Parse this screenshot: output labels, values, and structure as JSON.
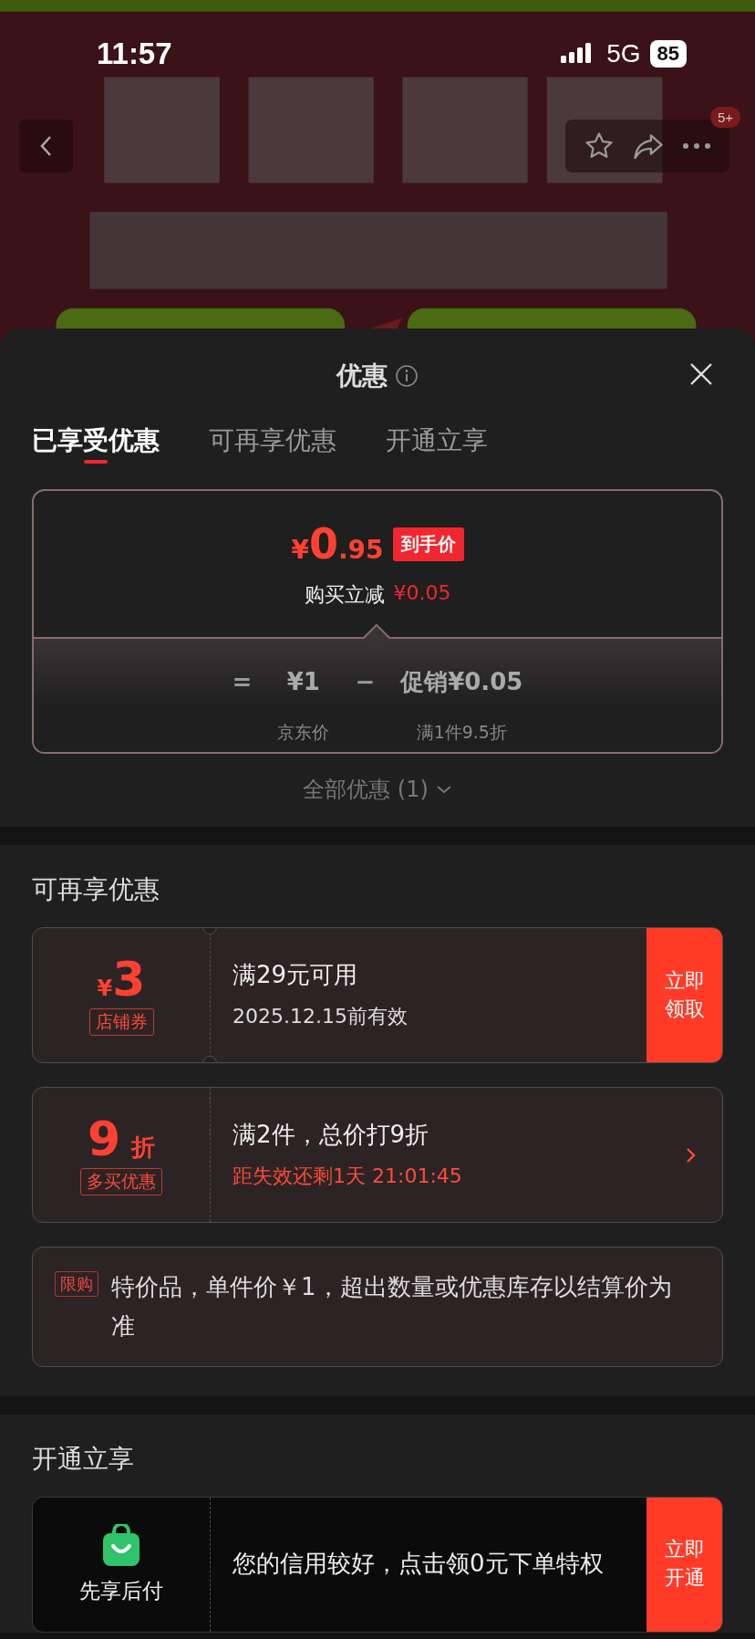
{
  "status_bar": {
    "time": "11:57",
    "network": "5G",
    "battery": "85"
  },
  "nav": {
    "badge": "5+"
  },
  "sheet": {
    "title": "优惠",
    "tabs": [
      {
        "label": "已享受优惠",
        "selected": true
      },
      {
        "label": "可再享优惠",
        "selected": false
      },
      {
        "label": "开通立享",
        "selected": false
      }
    ],
    "applied": {
      "price_symbol": "¥",
      "price_int": "0",
      "price_dec": ".95",
      "price_tag": "到手价",
      "reduction_label": "购买立减",
      "reduction_value": "¥0.05",
      "equals": "=",
      "jd_price": "¥1",
      "minus": "−",
      "promo": "促销¥0.05",
      "jd_label": "京东价",
      "promo_label": "满1件9.5折"
    },
    "all_link": "全部优惠 (1)"
  },
  "more": {
    "title": "可再享优惠",
    "offers": [
      {
        "kind": "coupon",
        "symbol": "¥",
        "amount": "3",
        "tag": "店铺券",
        "line1": "满29元可用",
        "line2": "2025.12.15前有效",
        "action": "立即领取"
      },
      {
        "kind": "discount",
        "amount": "9",
        "unit": "折",
        "tag": "多买优惠",
        "line1": "满2件，总价打9折",
        "line2": "距失效还剩1天 21:01:45"
      }
    ],
    "note": {
      "tag": "限购",
      "text": "特价品，单件价￥1，超出数量或优惠库存以结算价为准"
    }
  },
  "open": {
    "title": "开通立享",
    "card": {
      "label": "先享后付",
      "text": "您的信用较好，点击领0元下单特权",
      "action": "立即开通"
    }
  }
}
